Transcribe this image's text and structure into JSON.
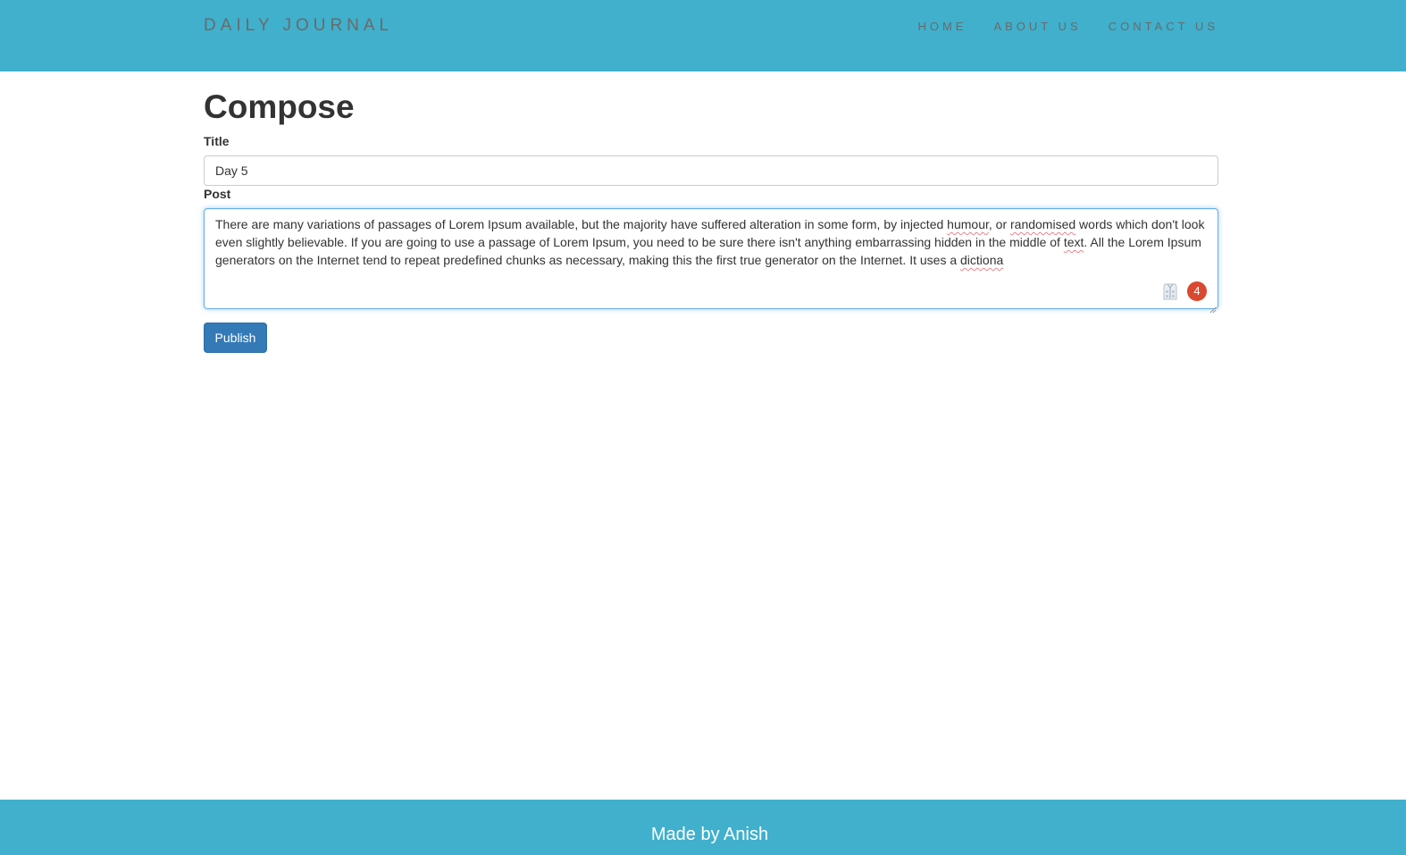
{
  "navbar": {
    "brand": "DAILY JOURNAL",
    "links": [
      {
        "label": "HOME"
      },
      {
        "label": "ABOUT US"
      },
      {
        "label": "CONTACT US"
      }
    ]
  },
  "compose": {
    "heading": "Compose",
    "title_label": "Title",
    "title_value": "Day 5",
    "post_label": "Post",
    "post_segments": [
      "There are many variations of passages of Lorem Ipsum available, but the majority have suffered alteration in some form, by injected ",
      "humour",
      ", or ",
      "randomised",
      " words which don't look even slightly believable. If you are going to use a passage of Lorem Ipsum, you need to be sure there isn't anything embarrassing hidden in the middle of ",
      "text",
      ". All the Lorem Ipsum generators on the Internet tend to repeat predefined chunks as necessary, making this the first true generator on the Internet. It uses a ",
      "dictiona"
    ],
    "grammar_issue_count": "4",
    "publish_label": "Publish"
  },
  "footer": {
    "text": "Made by Anish"
  },
  "colors": {
    "header_footer_bg": "#40b0cc",
    "nav_text": "#6a6a6a",
    "primary_button": "#337ab7",
    "focus_border": "#66afe9",
    "badge_red": "#d9482f",
    "spell_underline": "#e8848c"
  },
  "icons": {
    "grammar_checker": "grammar-checker-icon",
    "resize": "resize-handle-icon"
  }
}
